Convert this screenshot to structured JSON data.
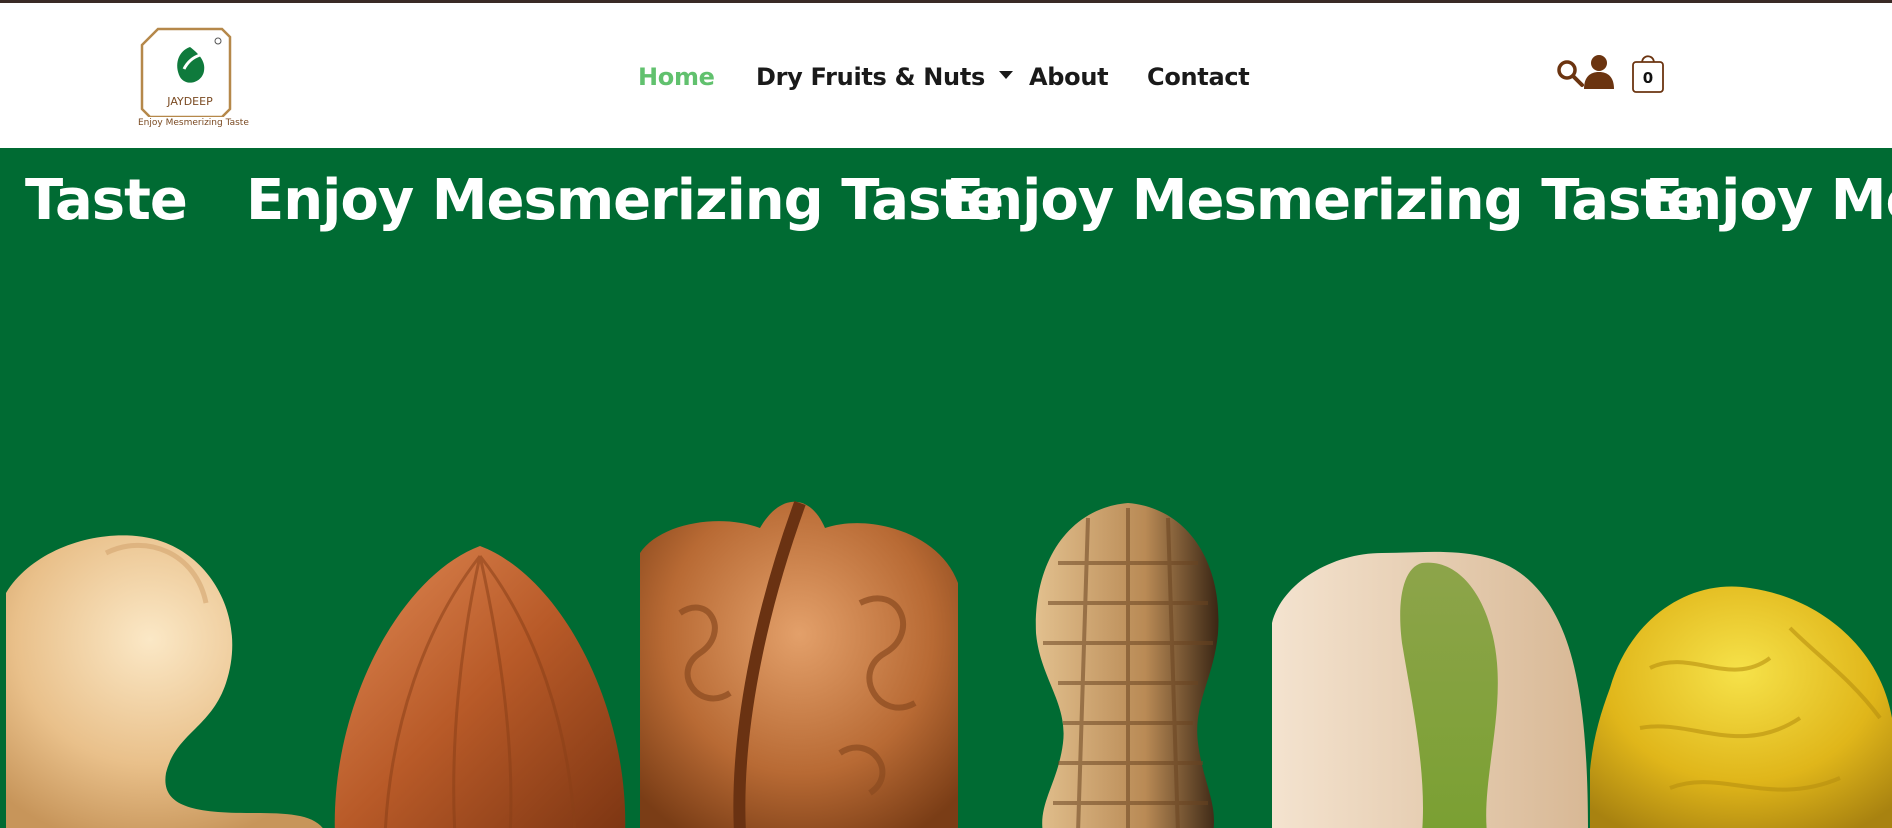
{
  "brand": {
    "logo_text": "JAYDEEP",
    "tagline": "Enjoy Mesmerizing Taste",
    "logo_color": "#b5884a"
  },
  "nav": {
    "items": [
      {
        "label": "Home",
        "active": true
      },
      {
        "label": "Dry Fruits & Nuts",
        "active": false,
        "has_dropdown": true
      },
      {
        "label": "About",
        "active": false
      },
      {
        "label": "Contact",
        "active": false
      }
    ]
  },
  "header_actions": {
    "search_icon": "search-icon",
    "account_icon": "user-icon",
    "cart_icon": "shopping-bag-icon",
    "cart_count": "0"
  },
  "hero": {
    "background": "#006b33",
    "marquee": [
      "Taste",
      "Enjoy Mesmerizing Taste",
      "Enjoy Mesmerizing Taste",
      "Enjoy Mes"
    ],
    "nuts": [
      "cashew",
      "almond",
      "walnut",
      "peanut",
      "pistachio",
      "raisin"
    ]
  },
  "colors": {
    "accent_green": "#61c16e",
    "icon_brown": "#6b3410"
  }
}
